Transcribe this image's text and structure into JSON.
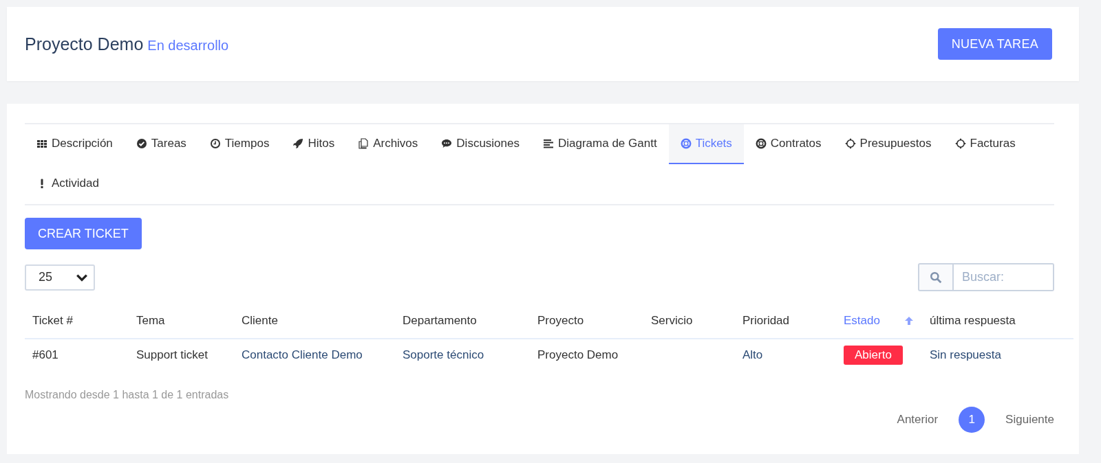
{
  "header": {
    "title": "Proyecto Demo",
    "status": "En desarrollo",
    "button": "NUEVA TAREA"
  },
  "tabs": [
    {
      "label": "Descripción",
      "selected": false
    },
    {
      "label": "Tareas",
      "selected": false
    },
    {
      "label": "Tiempos",
      "selected": false
    },
    {
      "label": "Hitos",
      "selected": false
    },
    {
      "label": "Archivos",
      "selected": false
    },
    {
      "label": "Discusiones",
      "selected": false
    },
    {
      "label": "Diagrama de Gantt",
      "selected": false
    },
    {
      "label": "Tickets",
      "selected": true
    },
    {
      "label": "Contratos",
      "selected": false
    },
    {
      "label": "Presupuestos",
      "selected": false
    },
    {
      "label": "Facturas",
      "selected": false
    },
    {
      "label": "Actividad",
      "selected": false
    }
  ],
  "create_button": "CREAR TICKET",
  "page_size": "25",
  "search": {
    "placeholder": "Buscar:"
  },
  "table": {
    "columns": [
      {
        "label": "Ticket #",
        "sorted": false
      },
      {
        "label": "Tema",
        "sorted": false
      },
      {
        "label": "Cliente",
        "sorted": false
      },
      {
        "label": "Departamento",
        "sorted": false
      },
      {
        "label": "Proyecto",
        "sorted": false
      },
      {
        "label": "Servicio",
        "sorted": false
      },
      {
        "label": "Prioridad",
        "sorted": false
      },
      {
        "label": "Estado",
        "sorted": true
      },
      {
        "label": "última respuesta",
        "sorted": false
      }
    ],
    "rows": [
      {
        "cells": [
          {
            "kind": "text",
            "text": "#601"
          },
          {
            "kind": "text",
            "text": "Support ticket"
          },
          {
            "kind": "link",
            "text": "Contacto Cliente Demo"
          },
          {
            "kind": "link",
            "text": "Soporte técnico"
          },
          {
            "kind": "text",
            "text": "Proyecto Demo"
          },
          {
            "kind": "empty"
          },
          {
            "kind": "link",
            "text": "Alto"
          },
          {
            "kind": "badge",
            "text": "Abierto",
            "color": "#ff2d46"
          },
          {
            "kind": "link",
            "text": "Sin respuesta"
          }
        ]
      }
    ]
  },
  "info": "Mostrando desde 1 hasta 1 de 1 entradas",
  "pagination": {
    "previous": "Anterior",
    "pages": [
      {
        "label": "1",
        "selected": true
      }
    ],
    "next": "Siguiente"
  }
}
